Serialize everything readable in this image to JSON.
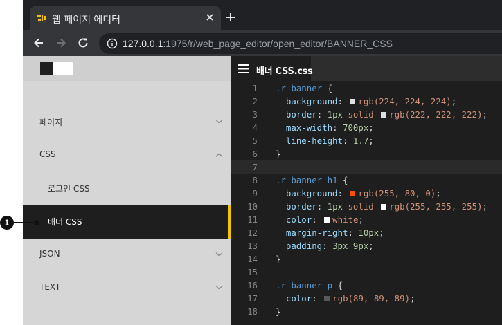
{
  "browser": {
    "tab_title": "웹 페이지 에디터",
    "url_host": "127.0.0.1",
    "url_rest": ":1975/r/web_page_editor/open_editor/BANNER_CSS"
  },
  "sidebar": {
    "menu": {
      "pages": "페이지",
      "css": "CSS",
      "css_login": "로그인 CSS",
      "css_banner": "배너 CSS",
      "json": "JSON",
      "text": "TEXT"
    }
  },
  "callout": {
    "number": "1"
  },
  "editor": {
    "tab_label": "배너 CSS.css",
    "line_numbers": [
      "1",
      "2",
      "3",
      "4",
      "5",
      "6",
      "7",
      "8",
      "9",
      "10",
      "11",
      "12",
      "13",
      "14",
      "15",
      "16",
      "17",
      "18"
    ],
    "code": {
      "r1_sel": ".r_banner",
      "r1_p1": "background",
      "r1_v1": "rgb(224, 224, 224)",
      "r1_p2": "border",
      "r1_v2a": "1px",
      "r1_v2b": "solid",
      "r1_v2c": "rgb(222, 222, 222)",
      "r1_p3": "max-width",
      "r1_v3": "700px",
      "r1_p4": "line-height",
      "r1_v4": "1.7",
      "r2_sel": ".r_banner h1",
      "r2_p1": "background",
      "r2_v1": "rgb(255, 80, 0)",
      "r2_p2": "border",
      "r2_v2a": "1px",
      "r2_v2b": "solid",
      "r2_v2c": "rgb(255, 255, 255)",
      "r2_p3": "color",
      "r2_v3": "white",
      "r2_p4": "margin-right",
      "r2_v4": "10px",
      "r2_p5": "padding",
      "r2_v5": "3px 9px",
      "r3_sel": ".r_banner p",
      "r3_p1": "color",
      "r3_v1": "rgb(89, 89, 89)"
    }
  },
  "colors": {
    "swatch_1": "#e0e0e0",
    "swatch_2": "#dedede",
    "swatch_3": "#ff5000",
    "swatch_4": "#ffffff",
    "swatch_5": "#ffffff",
    "swatch_6": "#595959",
    "active_accent": "#f5c400"
  }
}
